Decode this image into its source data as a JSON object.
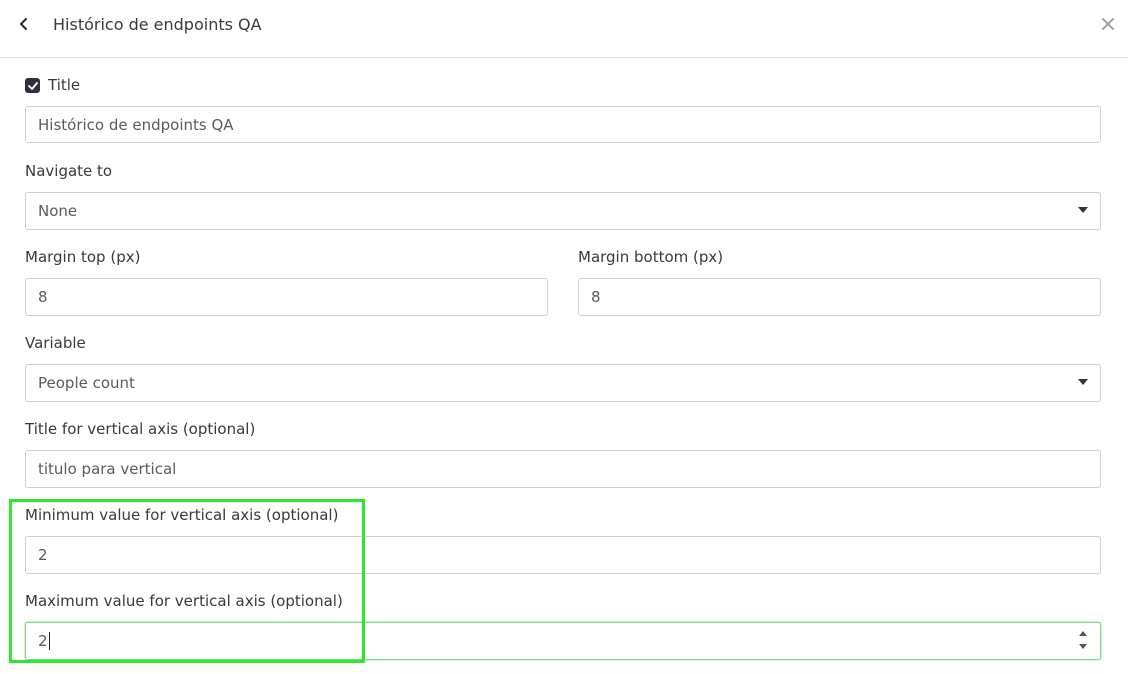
{
  "header": {
    "title": "Histórico de endpoints QA"
  },
  "form": {
    "title_checkbox_label": "Title",
    "title_value": "Histórico de endpoints QA",
    "navigate_label": "Navigate to",
    "navigate_value": "None",
    "margin_top_label": "Margin top (px)",
    "margin_top_value": "8",
    "margin_bottom_label": "Margin bottom (px)",
    "margin_bottom_value": "8",
    "variable_label": "Variable",
    "variable_value": "People count",
    "vaxis_title_label": "Title for vertical axis (optional)",
    "vaxis_title_value": "titulo para vertical",
    "vaxis_min_label": "Minimum value for vertical axis (optional)",
    "vaxis_min_value": "2",
    "vaxis_max_label": "Maximum value for vertical axis (optional)",
    "vaxis_max_value": "2"
  },
  "colors": {
    "highlight": "#2ee82e",
    "focus_border": "#7fd97f"
  }
}
